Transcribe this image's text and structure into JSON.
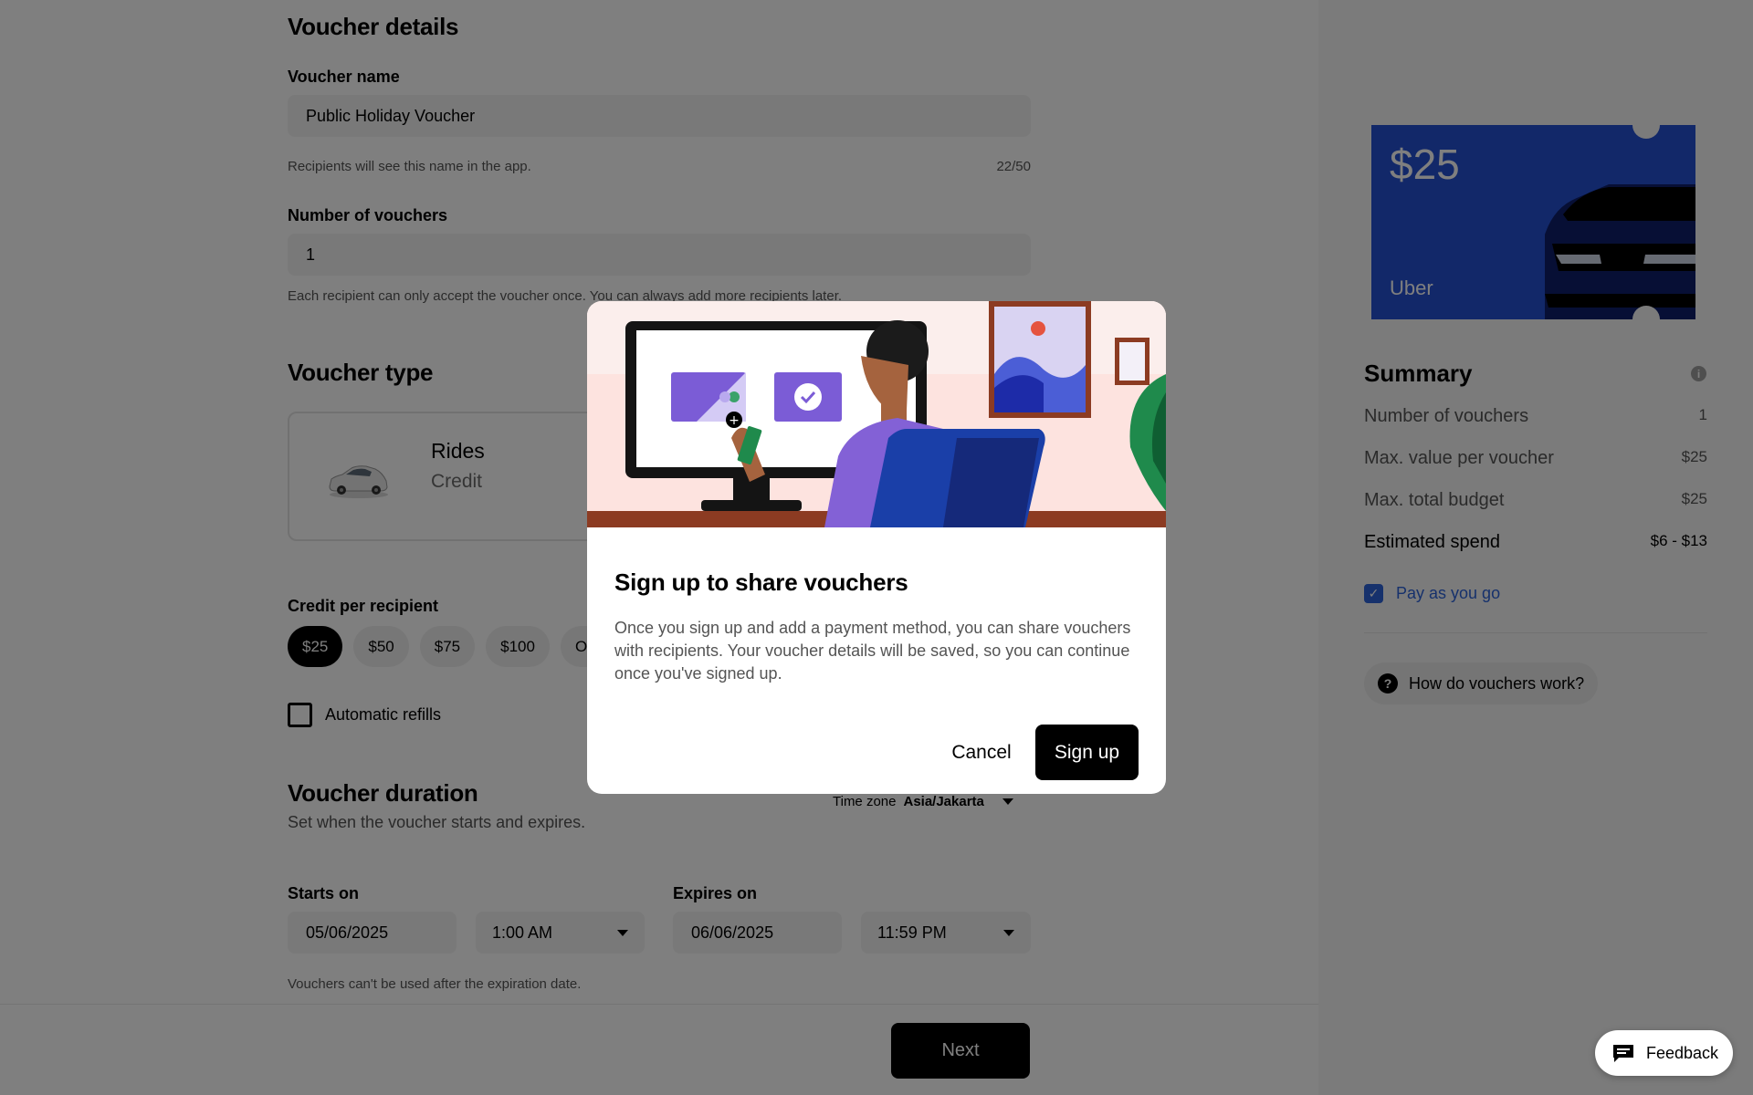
{
  "form": {
    "details": {
      "title": "Voucher details",
      "name_label": "Voucher name",
      "name_value": "Public Holiday Voucher",
      "name_hint": "Recipients will see this name in the app.",
      "name_counter": "22/50",
      "count_label": "Number of vouchers",
      "count_value": "1",
      "count_hint": "Each recipient can only accept the voucher once. You can always add more recipients later."
    },
    "type": {
      "title": "Voucher type",
      "card_name": "Rides",
      "card_sub": "Credit"
    },
    "credit": {
      "label": "Credit per recipient",
      "options": [
        "$25",
        "$50",
        "$75",
        "$100",
        "Other"
      ],
      "selected": "$25"
    },
    "refills_label": "Automatic refills",
    "duration": {
      "title": "Voucher duration",
      "subtitle": "Set when the voucher starts and expires.",
      "timezone_label": "Time zone",
      "timezone_value": "Asia/Jakarta",
      "starts_label": "Starts on",
      "start_date": "05/06/2025",
      "start_time": "1:00 AM",
      "expires_label": "Expires on",
      "expire_date": "06/06/2025",
      "expire_time": "11:59 PM",
      "hint": "Vouchers can't be used after the expiration date."
    },
    "next_label": "Next"
  },
  "sidebar": {
    "voucher_amount": "$25",
    "voucher_brand": "Uber",
    "summary_title": "Summary",
    "rows": [
      {
        "label": "Number of vouchers",
        "value": "1"
      },
      {
        "label": "Max. value per voucher",
        "value": "$25"
      },
      {
        "label": "Max. total budget",
        "value": "$25"
      },
      {
        "label": "Estimated spend",
        "value": "$6 - $13"
      }
    ],
    "pay_as_you_go": "Pay as you go",
    "how_label": "How do vouchers work?"
  },
  "feedback_label": "Feedback",
  "modal": {
    "title": "Sign up to share vouchers",
    "body": "Once you sign up and add a payment method, you can share vouchers with recipients. Your voucher details will be saved, so you can continue once you've signed up.",
    "cancel_label": "Cancel",
    "signup_label": "Sign up"
  },
  "colors": {
    "voucher_card": "#2451d3",
    "link_blue": "#2d63d8",
    "overlay": "rgba(0,0,0,0.5)"
  }
}
